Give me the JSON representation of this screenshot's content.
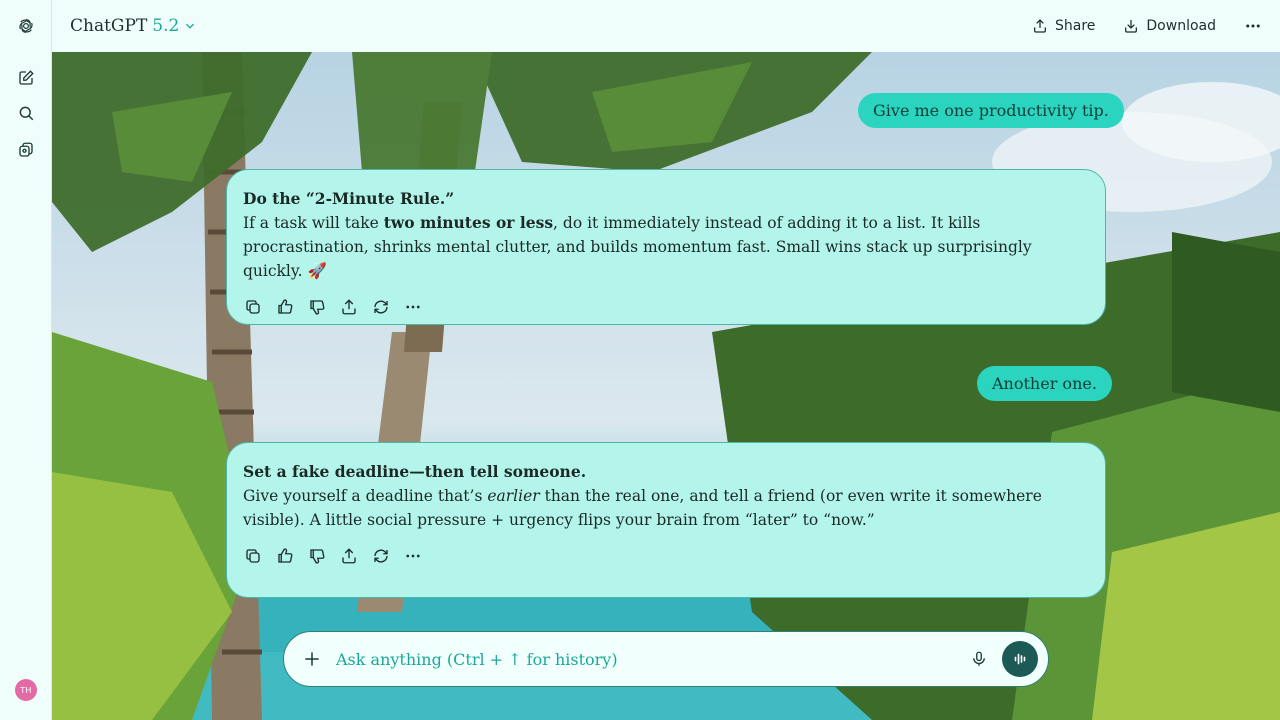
{
  "header": {
    "model_name": "ChatGPT",
    "model_version": "5.2",
    "share_label": "Share",
    "download_label": "Download"
  },
  "sidebar": {
    "avatar_initials": "TH",
    "icons": [
      "openai-logo-icon",
      "new-chat-icon",
      "search-icon",
      "library-icon"
    ]
  },
  "conversation": {
    "user_1": "Give me one productivity tip.",
    "assistant_1": {
      "heading": "Do the “2-Minute Rule.”",
      "pre": "If a task will take ",
      "bold": "two minutes or less",
      "post": ", do it immediately instead of adding it to a list. It kills procrastination, shrinks mental clutter, and builds momentum fast. Small wins stack up surprisingly quickly. 🚀"
    },
    "user_2": "Another one.",
    "assistant_2": {
      "heading": "Set a fake deadline—then tell someone.",
      "pre": "Give yourself a deadline that’s ",
      "italic": "earlier",
      "post": " than the real one, and tell a friend (or even write it somewhere visible). A little social pressure + urgency flips your brain from “later” to “now.”"
    }
  },
  "composer": {
    "placeholder": "Ask anything (Ctrl + ↑ for history)"
  },
  "colors": {
    "accent": "#1aa89a",
    "user_bubble": "#2ad4bf",
    "assistant_bubble": "#b3f5ea",
    "voice_button": "#1b5a55"
  }
}
